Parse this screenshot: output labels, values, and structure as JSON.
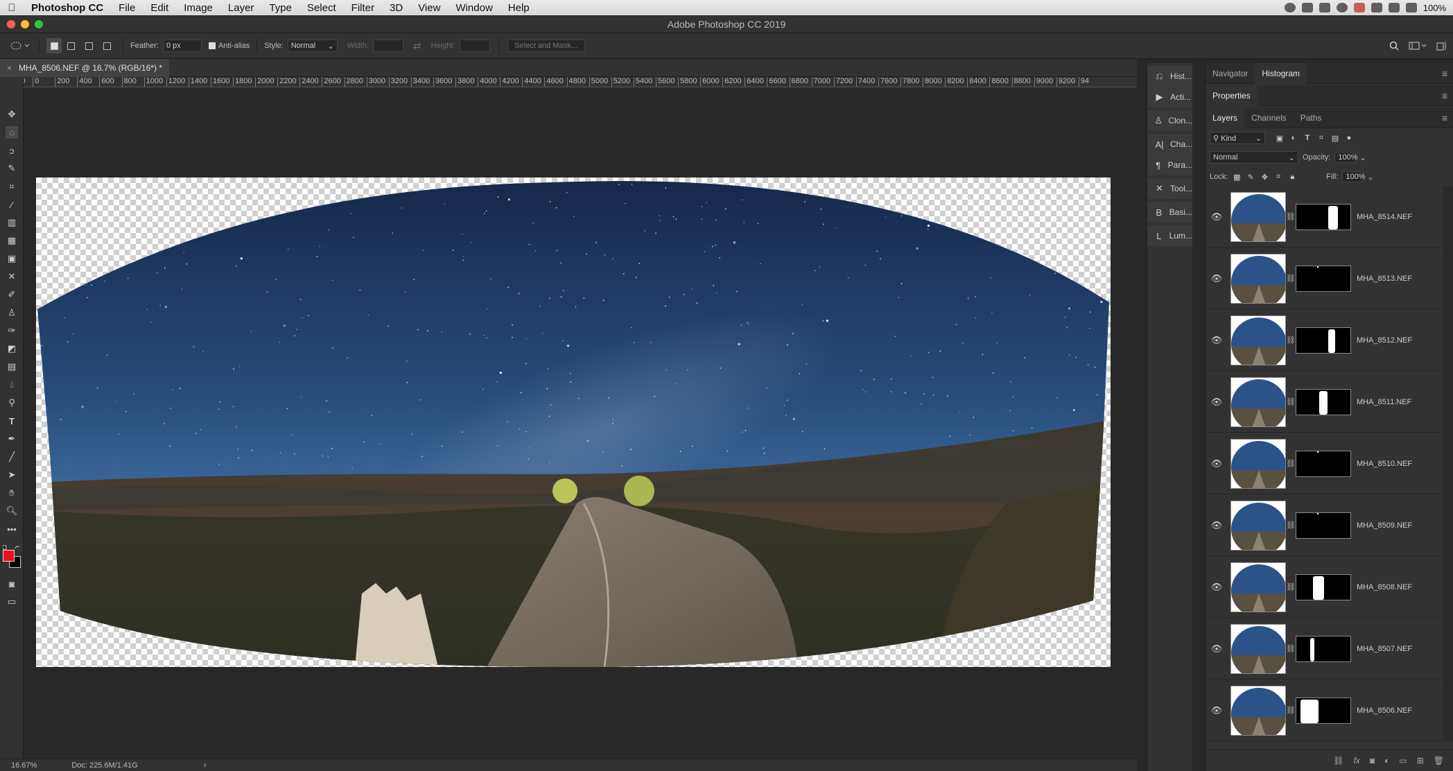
{
  "menubar": {
    "app_name": "Photoshop CC",
    "menus": [
      "File",
      "Edit",
      "Image",
      "Layer",
      "Type",
      "Select",
      "Filter",
      "3D",
      "View",
      "Window",
      "Help"
    ],
    "battery": "100%"
  },
  "window": {
    "title": "Adobe Photoshop CC 2019"
  },
  "options_bar": {
    "feather_label": "Feather:",
    "feather_value": "0 px",
    "antialias_label": "Anti-alias",
    "style_label": "Style:",
    "style_value": "Normal",
    "width_label": "Width:",
    "height_label": "Height:",
    "select_mask_label": "Select and Mask..."
  },
  "document_tab": {
    "title": "MHA_8506.NEF @ 16.7% (RGB/16*) *"
  },
  "ruler_ticks": [
    "200",
    "0",
    "200",
    "400",
    "600",
    "800",
    "1000",
    "1200",
    "1400",
    "1600",
    "1800",
    "2000",
    "2200",
    "2400",
    "2600",
    "2800",
    "3000",
    "3200",
    "3400",
    "3600",
    "3800",
    "4000",
    "4200",
    "4400",
    "4600",
    "4800",
    "5000",
    "5200",
    "5400",
    "5600",
    "5800",
    "6000",
    "6200",
    "6400",
    "6600",
    "6800",
    "7000",
    "7200",
    "7400",
    "7600",
    "7800",
    "8000",
    "8200",
    "8400",
    "8600",
    "8800",
    "9000",
    "9200",
    "94"
  ],
  "status_bar": {
    "zoom": "16.67%",
    "doc_size": "Doc: 225.6M/1.41G",
    "arrow": "›"
  },
  "dock": [
    {
      "label": "Hist...",
      "icon": "history-icon"
    },
    {
      "label": "Acti...",
      "icon": "actions-icon"
    },
    {
      "label": "Clon...",
      "icon": "clone-source-icon"
    },
    {
      "label": "Cha...",
      "icon": "character-icon"
    },
    {
      "label": "Para...",
      "icon": "paragraph-icon"
    },
    {
      "label": "Tool...",
      "icon": "tool-presets-icon"
    },
    {
      "label": "Basi...",
      "icon": "basic-icon"
    },
    {
      "label": "Lum...",
      "icon": "luminosity-icon"
    }
  ],
  "panels": {
    "top_tabs": [
      "Navigator",
      "Histogram"
    ],
    "properties_tab": "Properties",
    "layer_tabs": [
      "Layers",
      "Channels",
      "Paths"
    ],
    "filter_kind": "Kind",
    "blend_mode": "Normal",
    "opacity_label": "Opacity:",
    "opacity_value": "100%",
    "lock_label": "Lock:",
    "fill_label": "Fill:",
    "fill_value": "100%"
  },
  "layers": [
    {
      "name": "MHA_8514.NEF"
    },
    {
      "name": "MHA_8513.NEF"
    },
    {
      "name": "MHA_8512.NEF"
    },
    {
      "name": "MHA_8511.NEF"
    },
    {
      "name": "MHA_8510.NEF"
    },
    {
      "name": "MHA_8509.NEF"
    },
    {
      "name": "MHA_8508.NEF"
    },
    {
      "name": "MHA_8507.NEF"
    },
    {
      "name": "MHA_8506.NEF"
    }
  ],
  "colors": {
    "foreground": "#e8101a",
    "background": "#000000",
    "accent_blue": "#1f3f6e"
  }
}
